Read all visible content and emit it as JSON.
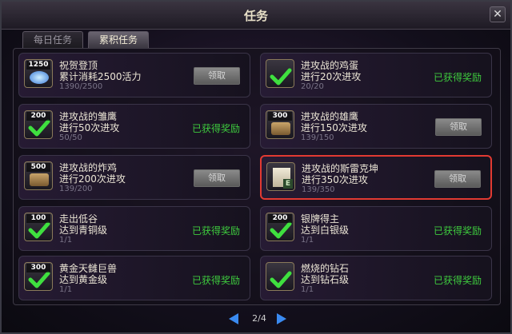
{
  "window": {
    "title": "任务",
    "close_icon": "close-icon",
    "close_glyph": "✕"
  },
  "tabs": [
    {
      "label": "每日任务",
      "active": false
    },
    {
      "label": "累积任务",
      "active": true
    }
  ],
  "quests": [
    {
      "badge": "1250",
      "icon": "energy-orb-icon",
      "name": "祝贺登顶",
      "desc": "累计消耗2500活力",
      "progress": "1390/2500",
      "state": "claim",
      "button": "领取"
    },
    {
      "badge": "",
      "icon": "check-icon",
      "name": "进攻战的鸡蛋",
      "desc": "进行20次进攻",
      "progress": "20/20",
      "state": "done",
      "status": "已获得奖励"
    },
    {
      "badge": "200",
      "icon": "check-icon",
      "name": "进攻战的雏鹰",
      "desc": "进行50次进攻",
      "progress": "50/50",
      "state": "done",
      "status": "已获得奖励"
    },
    {
      "badge": "300",
      "icon": "chest-icon",
      "name": "进攻战的雄鹰",
      "desc": "进行150次进攻",
      "progress": "139/150",
      "state": "claim",
      "button": "领取"
    },
    {
      "badge": "500",
      "icon": "chest-icon",
      "name": "进攻战的炸鸡",
      "desc": "进行200次进攻",
      "progress": "139/200",
      "state": "claim",
      "button": "领取"
    },
    {
      "badge": "",
      "icon": "stone-icon",
      "name": "进攻战的斯雷克坤",
      "desc": "进行350次进攻",
      "progress": "139/350",
      "state": "claim",
      "button": "领取",
      "highlighted": true
    },
    {
      "badge": "100",
      "icon": "check-icon",
      "name": "走出低谷",
      "desc": "达到青铜级",
      "progress": "1/1",
      "state": "done",
      "status": "已获得奖励"
    },
    {
      "badge": "200",
      "icon": "check-icon",
      "name": "银牌得主",
      "desc": "达到白银级",
      "progress": "1/1",
      "state": "done",
      "status": "已获得奖励"
    },
    {
      "badge": "300",
      "icon": "check-icon",
      "name": "黄金天雠巨兽",
      "desc": "达到黄金级",
      "progress": "1/1",
      "state": "done",
      "status": "已获得奖励"
    },
    {
      "badge": "",
      "icon": "check-icon",
      "name": "燃烧的钻石",
      "desc": "达到钻石级",
      "progress": "1/1",
      "state": "done",
      "status": "已获得奖励"
    }
  ],
  "pager": {
    "current": "2/4",
    "prev_icon": "arrow-left-icon",
    "next_icon": "arrow-right-icon"
  },
  "colors": {
    "status_green": "#3ecb3e",
    "highlight_red": "#e23a32",
    "pager_blue": "#3a8af0"
  }
}
